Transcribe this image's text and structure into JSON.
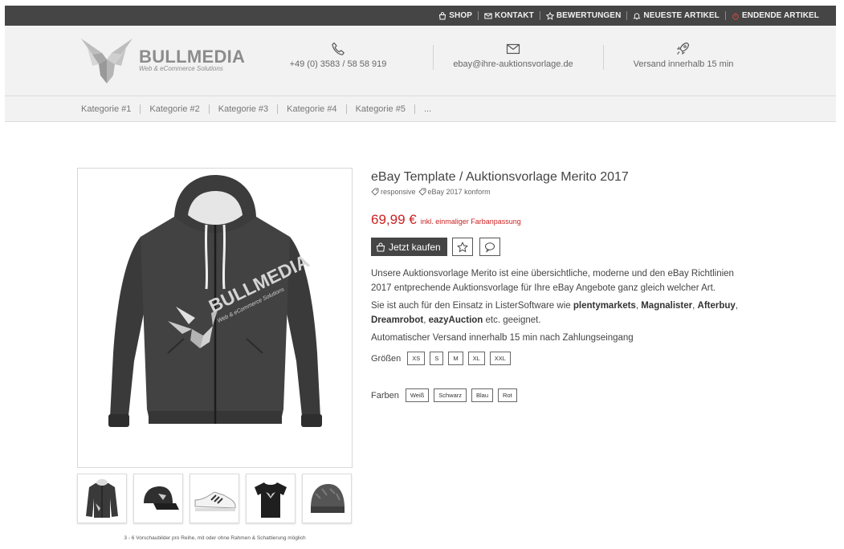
{
  "topnav": {
    "items": [
      {
        "label": "SHOP",
        "icon": "shopping-bag-icon"
      },
      {
        "label": "KONTAKT",
        "icon": "envelope-icon"
      },
      {
        "label": "BEWERTUNGEN",
        "icon": "star-icon"
      },
      {
        "label": "NEUESTE ARTIKEL",
        "icon": "bell-icon"
      },
      {
        "label": "ENDENDE ARTIKEL",
        "icon": "timer-icon"
      }
    ],
    "ending_icon_color": "#e0453a"
  },
  "header": {
    "logo_name": "BULLMEDIA",
    "logo_tagline": "Web & eCommerce Solutions",
    "phone": "+49 (0) 3583 / 58 58 919",
    "email": "ebay@ihre-auktionsvorlage.de",
    "shipping": "Versand innerhalb 15 min"
  },
  "categories": [
    "Kategorie #1",
    "Kategorie #2",
    "Kategorie #3",
    "Kategorie #4",
    "Kategorie #5",
    "..."
  ],
  "gallery": {
    "main_overlay_text": "BULLMEDIA",
    "main_overlay_sub": "Web & eCommerce Solutions",
    "thumb_icons": [
      "hoodie-icon",
      "cap-icon",
      "sneaker-icon",
      "tshirt-icon",
      "beanie-icon"
    ],
    "caption": "3 - 6 Vorschaubilder pro Reihe, mit oder ohne Rahmen & Schattierung möglich"
  },
  "product": {
    "title": "eBay Template / Auktionsvorlage Merito 2017",
    "tags": [
      "responsive",
      "eBay 2017 konform"
    ],
    "price": "69,99 €",
    "price_note": "inkl. einmaliger Farbanpassung",
    "buy_label": "Jetzt kaufen",
    "desc1": "Unsere Auktionsvorlage Merito ist eine übersichtliche, moderne und den eBay Richtlinien 2017 entprechende Auktionsvorlage für Ihre eBay Angebote ganz gleich welcher Art.",
    "desc2_intro": "Sie ist auch für den Einsatz in ListerSoftware wie ",
    "desc2_brands": [
      "plentymarkets",
      "Magnalister",
      "Afterbuy",
      "Dreamrobot",
      "eazyAuction"
    ],
    "desc2_sep": ", ",
    "desc2_outro": " etc. geeignet.",
    "desc3": "Automatischer Versand innerhalb 15 min nach Zahlungseingang",
    "sizes_label": "Größen",
    "sizes": [
      "XS",
      "S",
      "M",
      "XL",
      "XXL"
    ],
    "colors_label": "Farben",
    "colors": [
      "Weiß",
      "Schwarz",
      "Blau",
      "Rot"
    ],
    "price_color": "#cc2222"
  }
}
